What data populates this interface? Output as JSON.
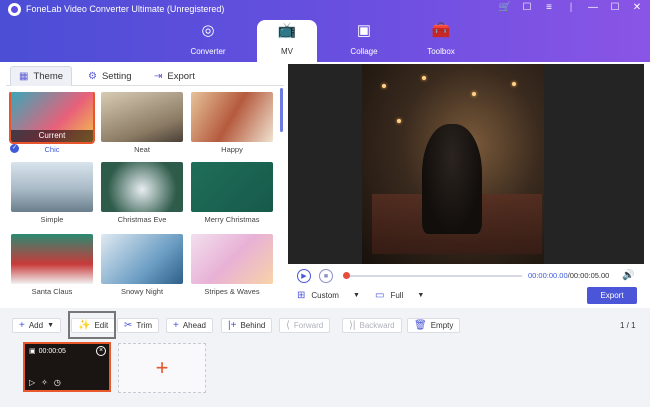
{
  "app": {
    "title": "FoneLab Video Converter Ultimate (Unregistered)",
    "window_controls": [
      "cart-icon",
      "feedback-icon",
      "menu-icon",
      "minimize-icon",
      "maximize-icon",
      "close-icon"
    ]
  },
  "nav": {
    "tabs": [
      {
        "label": "Converter",
        "icon": "converter-icon"
      },
      {
        "label": "MV",
        "icon": "mv-icon",
        "active": true
      },
      {
        "label": "Collage",
        "icon": "collage-icon"
      },
      {
        "label": "Toolbox",
        "icon": "toolbox-icon"
      }
    ]
  },
  "subtabs": [
    {
      "label": "Theme",
      "icon": "theme-icon",
      "active": true
    },
    {
      "label": "Setting",
      "icon": "gear-icon"
    },
    {
      "label": "Export",
      "icon": "export-icon"
    }
  ],
  "themes": [
    {
      "label": "Chic",
      "selected": true,
      "badge": "Current"
    },
    {
      "label": "Neat"
    },
    {
      "label": "Happy"
    },
    {
      "label": "Simple"
    },
    {
      "label": "Christmas Eve"
    },
    {
      "label": "Merry Christmas"
    },
    {
      "label": "Santa Claus"
    },
    {
      "label": "Snowy Night"
    },
    {
      "label": "Stripes & Waves"
    }
  ],
  "player": {
    "current_time": "00:00:00.00",
    "total_time": "00:00:05.00",
    "aspect": "Custom",
    "display": "Full",
    "export_label": "Export"
  },
  "toolbar": {
    "add": "Add",
    "edit": "Edit",
    "trim": "Trim",
    "ahead": "Ahead",
    "behind": "Behind",
    "forward": "Forward",
    "backward": "Backward",
    "empty": "Empty",
    "page": "1 / 1"
  },
  "clip": {
    "duration": "00:00:05"
  },
  "colors": {
    "accent": "#4a55d8",
    "header_start": "#4b4ed6",
    "header_end": "#8a55e6",
    "selection": "#e7552c"
  }
}
